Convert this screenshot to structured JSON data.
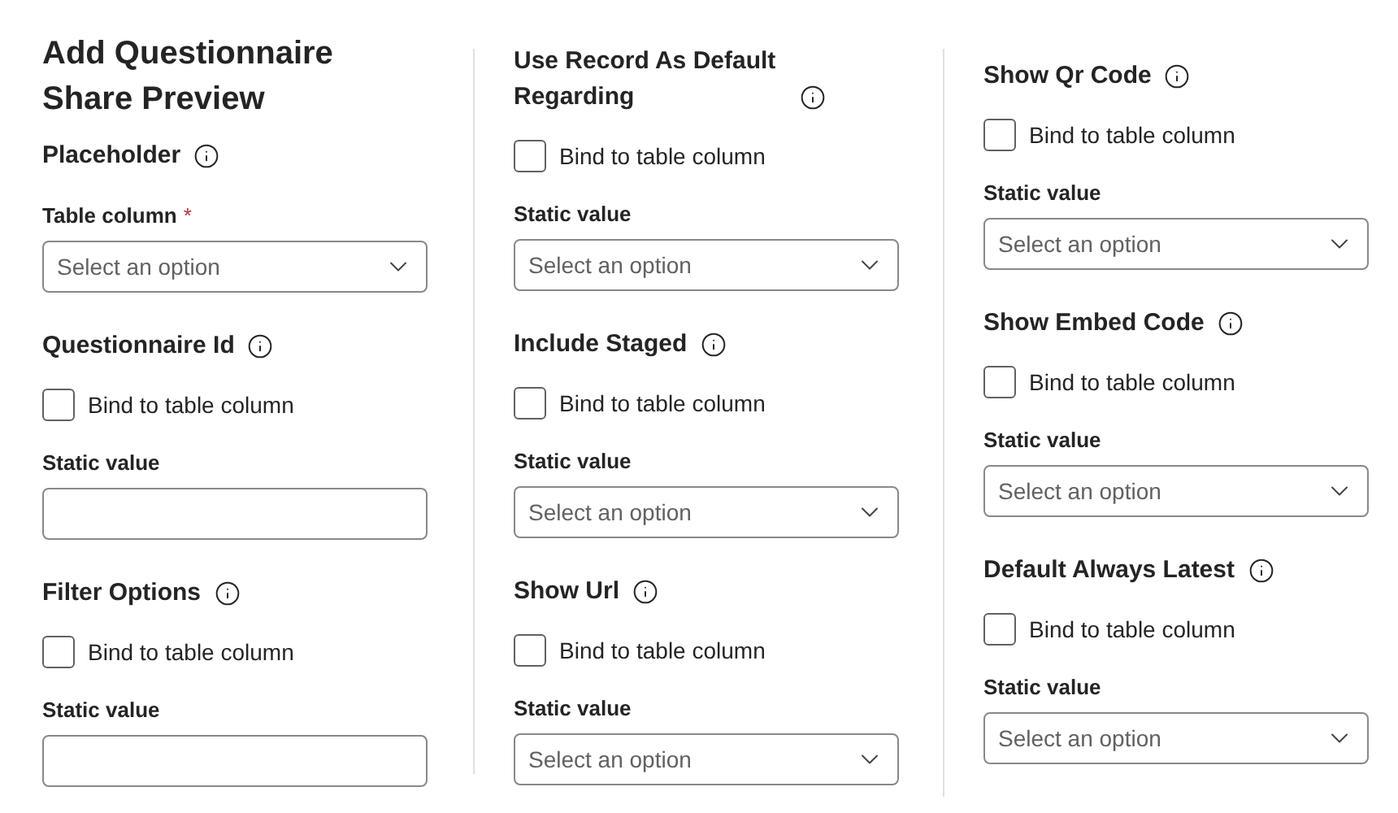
{
  "columns": [
    {
      "title": "Add Questionnaire Share Preview",
      "sections": [
        {
          "heading": "Placeholder",
          "info": true,
          "items": [
            {
              "kind": "dropdown",
              "label": "Table column",
              "required_mark": "*",
              "placeholder": "Select an option"
            }
          ]
        },
        {
          "heading": "Questionnaire Id",
          "info": true,
          "items": [
            {
              "kind": "checkbox",
              "label": "Bind to table column",
              "checked": false
            },
            {
              "kind": "text",
              "label": "Static value"
            }
          ]
        },
        {
          "heading": "Filter Options",
          "info": true,
          "items": [
            {
              "kind": "checkbox",
              "label": "Bind to table column",
              "checked": false
            },
            {
              "kind": "text",
              "label": "Static value"
            }
          ]
        }
      ]
    },
    {
      "sections": [
        {
          "heading": "Use Record As Default Regarding",
          "info": true,
          "items": [
            {
              "kind": "checkbox",
              "label": "Bind to table column",
              "checked": false
            },
            {
              "kind": "dropdown",
              "label": "Static value",
              "placeholder": "Select an option"
            }
          ]
        },
        {
          "heading": "Include Staged",
          "info": true,
          "items": [
            {
              "kind": "checkbox",
              "label": "Bind to table column",
              "checked": false
            },
            {
              "kind": "dropdown",
              "label": "Static value",
              "placeholder": "Select an option"
            }
          ]
        },
        {
          "heading": "Show Url",
          "info": true,
          "items": [
            {
              "kind": "checkbox",
              "label": "Bind to table column",
              "checked": false
            },
            {
              "kind": "dropdown",
              "label": "Static value",
              "placeholder": "Select an option"
            }
          ]
        }
      ]
    },
    {
      "sections": [
        {
          "heading": "Show Qr Code",
          "info": true,
          "items": [
            {
              "kind": "checkbox",
              "label": "Bind to table column",
              "checked": false
            },
            {
              "kind": "dropdown",
              "label": "Static value",
              "placeholder": "Select an option"
            }
          ]
        },
        {
          "heading": "Show Embed Code",
          "info": true,
          "items": [
            {
              "kind": "checkbox",
              "label": "Bind to table column",
              "checked": false
            },
            {
              "kind": "dropdown",
              "label": "Static value",
              "placeholder": "Select an option"
            }
          ]
        },
        {
          "heading": "Default Always Latest",
          "info": true,
          "items": [
            {
              "kind": "checkbox",
              "label": "Bind to table column",
              "checked": false
            },
            {
              "kind": "dropdown",
              "label": "Static value",
              "placeholder": "Select an option"
            }
          ]
        }
      ]
    }
  ]
}
